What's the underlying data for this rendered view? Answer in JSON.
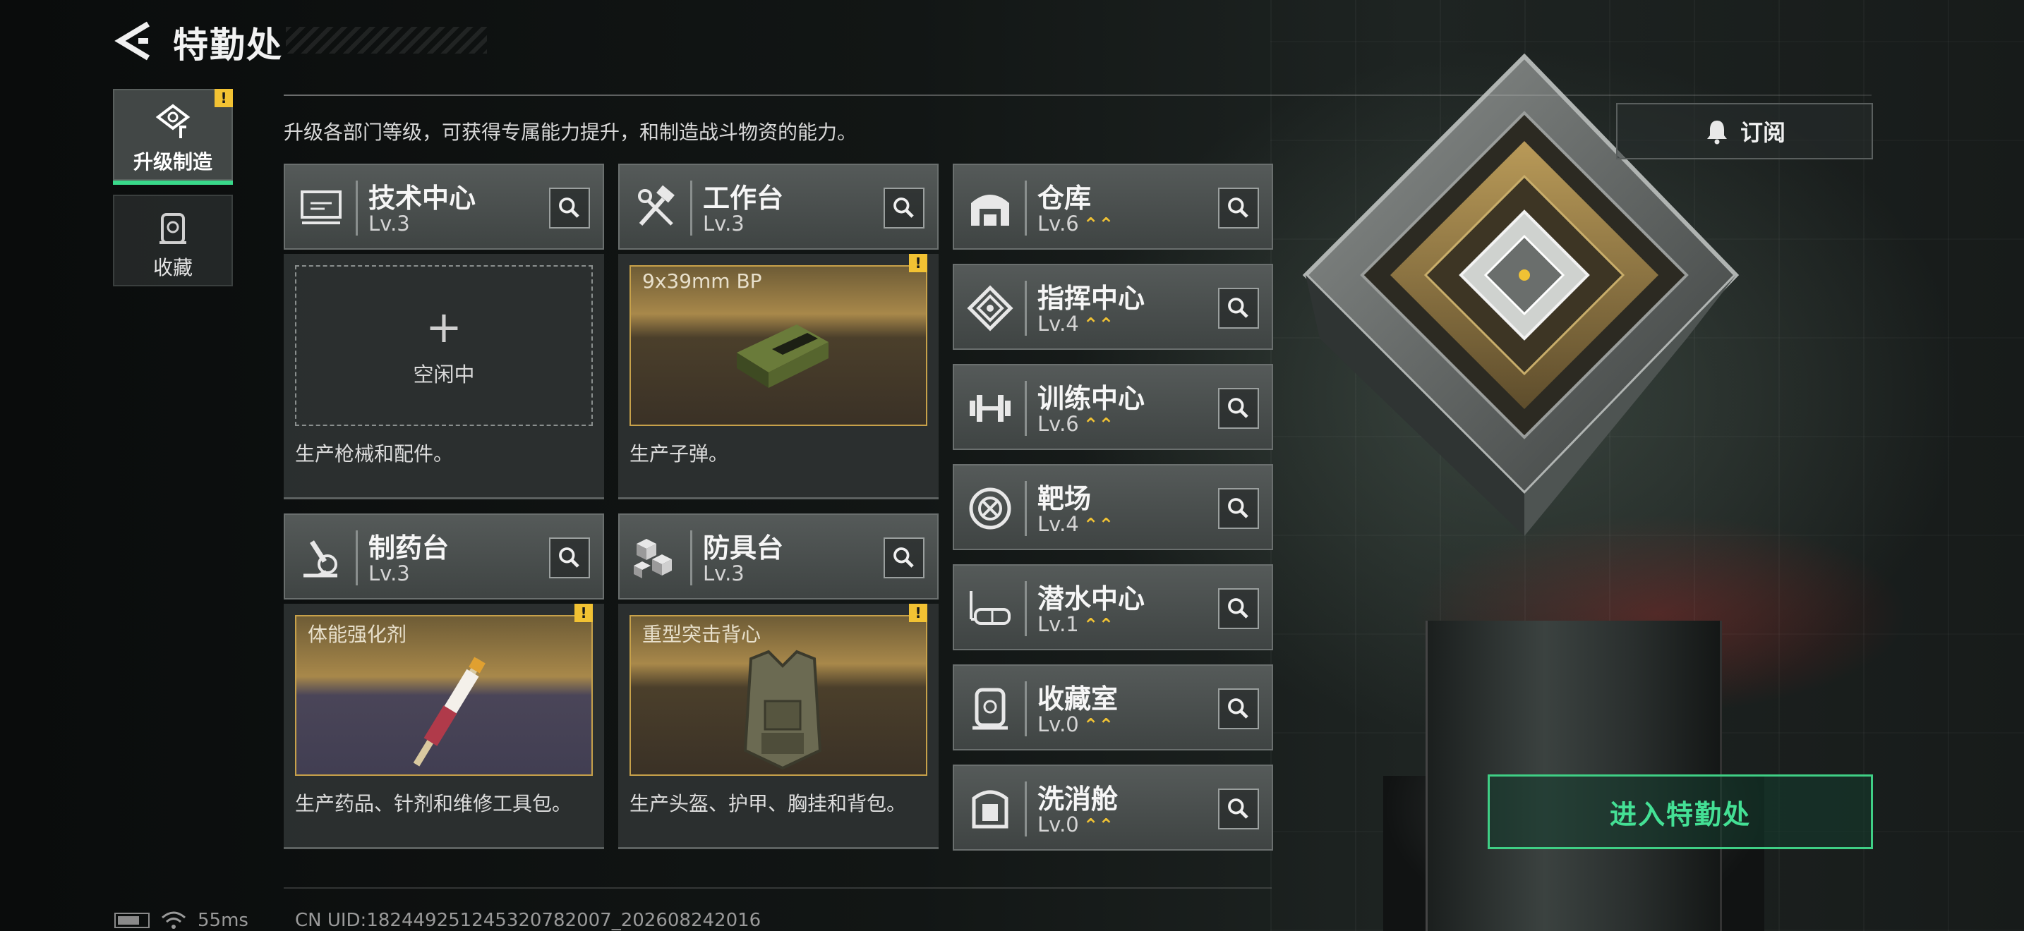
{
  "header": {
    "title": "特勤处"
  },
  "tabs": [
    {
      "label": "升级制造",
      "active": true,
      "alert": "!"
    },
    {
      "label": "收藏",
      "active": false
    }
  ],
  "description": "升级各部门等级，可获得专属能力提升，和制造战斗物资的能力。",
  "subscribe_label": "订阅",
  "production_departments": [
    {
      "name": "技术中心",
      "level": "Lv.3",
      "slot_state": "空闲中",
      "slot_plus": "+",
      "caption": "生产枪械和配件。"
    },
    {
      "name": "工作台",
      "level": "Lv.3",
      "item": "9x39mm BP",
      "alert": "!",
      "caption": "生产子弹。"
    },
    {
      "name": "制药台",
      "level": "Lv.3",
      "item": "体能强化剂",
      "alert": "!",
      "caption": "生产药品、针剂和维修工具包。"
    },
    {
      "name": "防具台",
      "level": "Lv.3",
      "item": "重型突击背心",
      "alert": "!",
      "caption": "生产头盔、护甲、胸挂和背包。"
    }
  ],
  "departments": [
    {
      "name": "仓库",
      "level": "Lv.6",
      "upgrade": "⌃⌃"
    },
    {
      "name": "指挥中心",
      "level": "Lv.4",
      "upgrade": "⌃⌃"
    },
    {
      "name": "训练中心",
      "level": "Lv.6",
      "upgrade": "⌃⌃"
    },
    {
      "name": "靶场",
      "level": "Lv.4",
      "upgrade": "⌃⌃"
    },
    {
      "name": "潜水中心",
      "level": "Lv.1",
      "upgrade": "⌃⌃"
    },
    {
      "name": "收藏室",
      "level": "Lv.0",
      "upgrade": "⌃⌃"
    },
    {
      "name": "洗消舱",
      "level": "Lv.0",
      "upgrade": "⌃⌃"
    }
  ],
  "enter_button": "进入特勤处",
  "status": {
    "ping": "55ms",
    "uid": "CN UID:18244925124532078​2007_202608242016"
  },
  "colors": {
    "accent_green": "#3fcf85",
    "alert_yellow": "#f2c233",
    "upgrade_gold": "#f0c234",
    "slot_border_gold": "#c7a14a"
  }
}
